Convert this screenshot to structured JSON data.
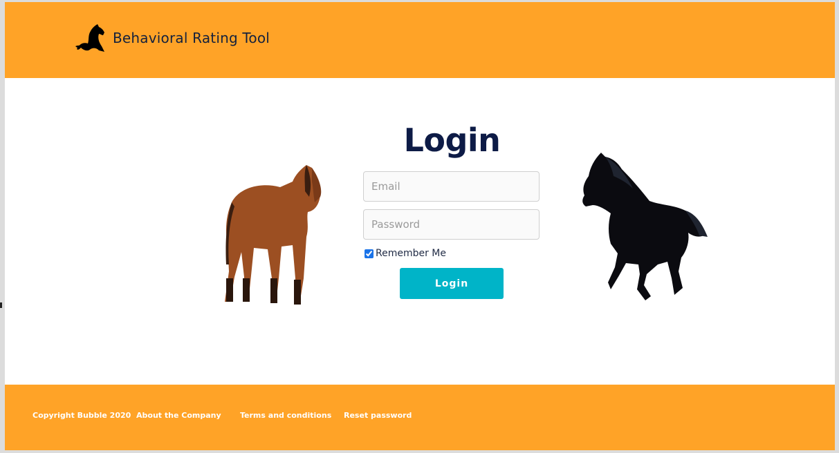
{
  "header": {
    "brand_title": "Behavioral Rating Tool",
    "logo_icon": "horse-silhouette-icon"
  },
  "login": {
    "title": "Login",
    "email_placeholder": "Email",
    "password_placeholder": "Password",
    "remember_label": "Remember Me",
    "remember_checked": true,
    "button_label": "Login"
  },
  "images": {
    "left": "brown-horse-image",
    "right": "black-horse-image"
  },
  "footer": {
    "copyright": "Copyright Bubble 2020",
    "about": "About the Company",
    "terms": "Terms and conditions",
    "reset": "Reset password"
  },
  "colors": {
    "header_bg": "#ffa327",
    "footer_bg": "#ffa327",
    "title_color": "#0d1b46",
    "button_bg": "#00b4c8"
  }
}
